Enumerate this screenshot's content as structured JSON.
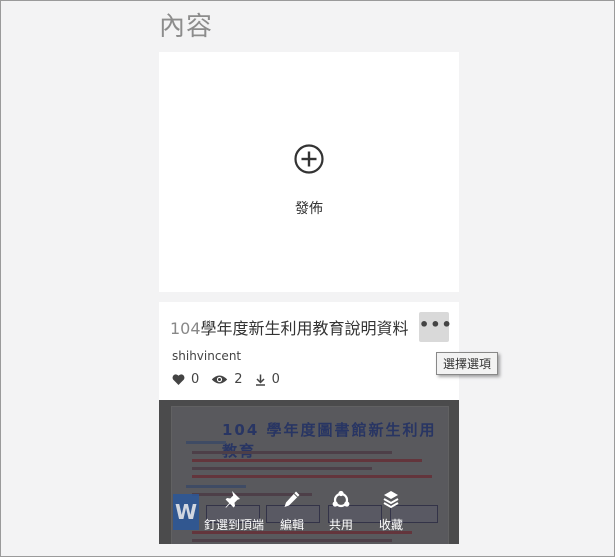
{
  "page": {
    "title": "內容"
  },
  "publish": {
    "label": "發佈",
    "icon": "add-circle-icon"
  },
  "doc": {
    "title_year": "104",
    "title_rest": "學年度新生利用教育說明資料",
    "author": "shihvincent",
    "likes": "0",
    "views": "2",
    "downloads": "0",
    "more_label": "•••",
    "tooltip": "選擇選項",
    "thumb_heading": "104 學年度圖書館新生利用教育",
    "file_badge": "W"
  },
  "actions": [
    {
      "label": "釘選到頂端",
      "icon": "pin-icon"
    },
    {
      "label": "編輯",
      "icon": "pencil-icon"
    },
    {
      "label": "共用",
      "icon": "share-icon"
    },
    {
      "label": "收藏",
      "icon": "stack-icon"
    }
  ],
  "colors": {
    "background": "#f3f3f4",
    "card": "#ffffff",
    "title_gray": "#8c8c8c",
    "word_blue": "#2b579a"
  }
}
